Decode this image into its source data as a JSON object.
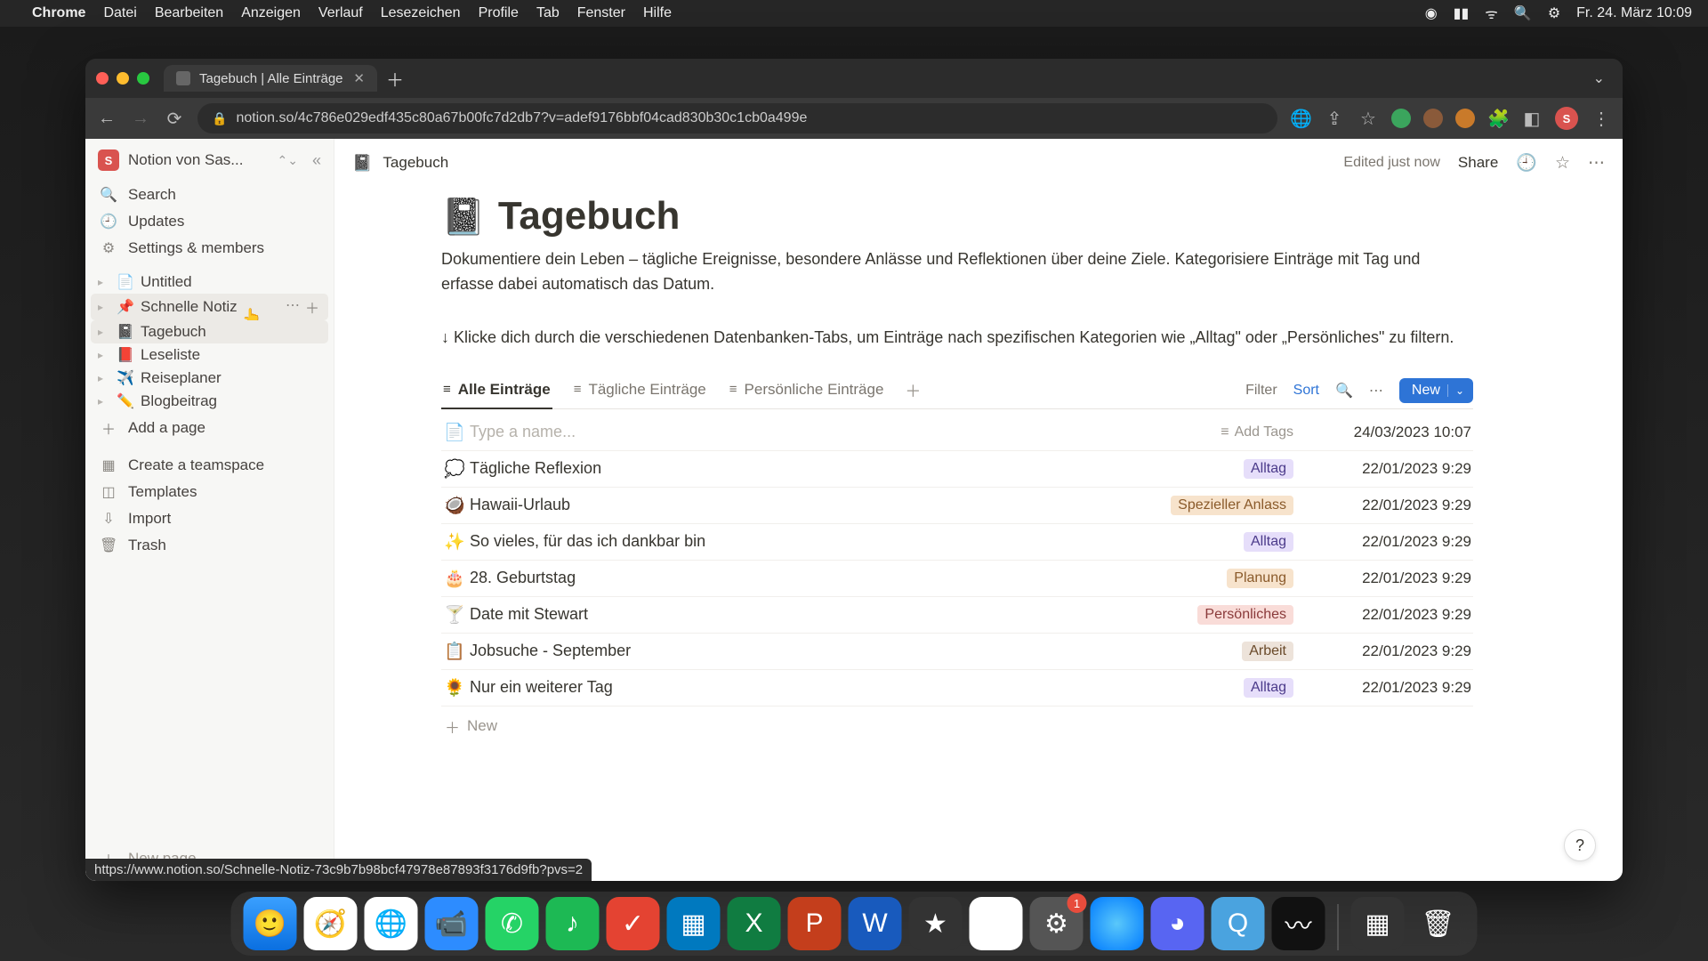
{
  "menubar": {
    "app": "Chrome",
    "items": [
      "Datei",
      "Bearbeiten",
      "Anzeigen",
      "Verlauf",
      "Lesezeichen",
      "Profile",
      "Tab",
      "Fenster",
      "Hilfe"
    ],
    "clock": "Fr. 24. März  10:09"
  },
  "browser": {
    "tab_title": "Tagebuch | Alle Einträge",
    "url": "notion.so/4c786e029edf435c80a67b00fc7d2db7?v=adef9176bbf04cad830b30c1cb0a499e",
    "avatar_letter": "S",
    "status_url": "https://www.notion.so/Schnelle-Notiz-73c9b7b98bcf47978e87893f3176d9fb?pvs=2"
  },
  "sidebar": {
    "workspace": "Notion von Sas...",
    "workspace_letter": "S",
    "search": "Search",
    "updates": "Updates",
    "settings": "Settings & members",
    "pages": [
      {
        "emoji": "📄",
        "label": "Untitled",
        "active": false,
        "hover": false
      },
      {
        "emoji": "📌",
        "label": "Schnelle Notiz",
        "active": false,
        "hover": true
      },
      {
        "emoji": "📓",
        "label": "Tagebuch",
        "active": true,
        "hover": false
      },
      {
        "emoji": "📕",
        "label": "Leseliste",
        "active": false,
        "hover": false
      },
      {
        "emoji": "✈️",
        "label": "Reiseplaner",
        "active": false,
        "hover": false
      },
      {
        "emoji": "✏️",
        "label": "Blogbeitrag",
        "active": false,
        "hover": false
      }
    ],
    "add_page": "Add a page",
    "teamspace": "Create a teamspace",
    "templates": "Templates",
    "import": "Import",
    "trash": "Trash",
    "new_page": "New page"
  },
  "topbar": {
    "breadcrumb_emoji": "📓",
    "breadcrumb": "Tagebuch",
    "edited": "Edited just now",
    "share": "Share"
  },
  "page": {
    "emoji": "📓",
    "title": "Tagebuch",
    "desc1": "Dokumentiere dein Leben – tägliche Ereignisse, besondere Anlässe und Reflektionen über deine Ziele. Kategorisiere Einträge mit Tag und erfasse dabei automatisch das Datum.",
    "desc2": "↓ Klicke dich durch die verschiedenen Datenbanken-Tabs, um Einträge nach spezifischen Kategorien wie „Alltag\" oder „Persönliches\" zu filtern."
  },
  "db": {
    "tabs": [
      {
        "icon": "≡",
        "label": "Alle Einträge",
        "active": true
      },
      {
        "icon": "≡",
        "label": "Tägliche Einträge",
        "active": false
      },
      {
        "icon": "≡",
        "label": "Persönliche Einträge",
        "active": false
      }
    ],
    "filter": "Filter",
    "sort": "Sort",
    "new": "New",
    "add_tags": "Add Tags",
    "placeholder": "Type a name...",
    "new_row": "New",
    "rows": [
      {
        "emoji": "📄",
        "title": "",
        "placeholder": true,
        "tag": null,
        "tagclass": "",
        "time": "24/03/2023 10:07"
      },
      {
        "emoji": "💭",
        "title": "Tägliche Reflexion",
        "tag": "Alltag",
        "tagclass": "tag-purple",
        "time": "22/01/2023 9:29"
      },
      {
        "emoji": "🥥",
        "title": "Hawaii-Urlaub",
        "tag": "Spezieller Anlass",
        "tagclass": "tag-orange",
        "time": "22/01/2023 9:29"
      },
      {
        "emoji": "✨",
        "title": "So vieles, für das ich dankbar bin",
        "tag": "Alltag",
        "tagclass": "tag-purple",
        "time": "22/01/2023 9:29"
      },
      {
        "emoji": "🎂",
        "title": "28. Geburtstag",
        "tag": "Planung",
        "tagclass": "tag-pinkish",
        "time": "22/01/2023 9:29"
      },
      {
        "emoji": "🍸",
        "title": "Date mit Stewart",
        "tag": "Persönliches",
        "tagclass": "tag-red",
        "time": "22/01/2023 9:29"
      },
      {
        "emoji": "📋",
        "title": "Jobsuche - September",
        "tag": "Arbeit",
        "tagclass": "tag-brown",
        "time": "22/01/2023 9:29"
      },
      {
        "emoji": "🌻",
        "title": "Nur ein weiterer Tag",
        "tag": "Alltag",
        "tagclass": "tag-purple",
        "time": "22/01/2023 9:29"
      }
    ]
  },
  "tag_colors": {
    "Alltag": "#e6defa",
    "Spezieller Anlass": "#f7e3cc",
    "Planung": "#f7e3cc",
    "Persönliches": "#f9dcd8",
    "Arbeit": "#ede3da"
  },
  "dock": {
    "badge_count": "1"
  }
}
